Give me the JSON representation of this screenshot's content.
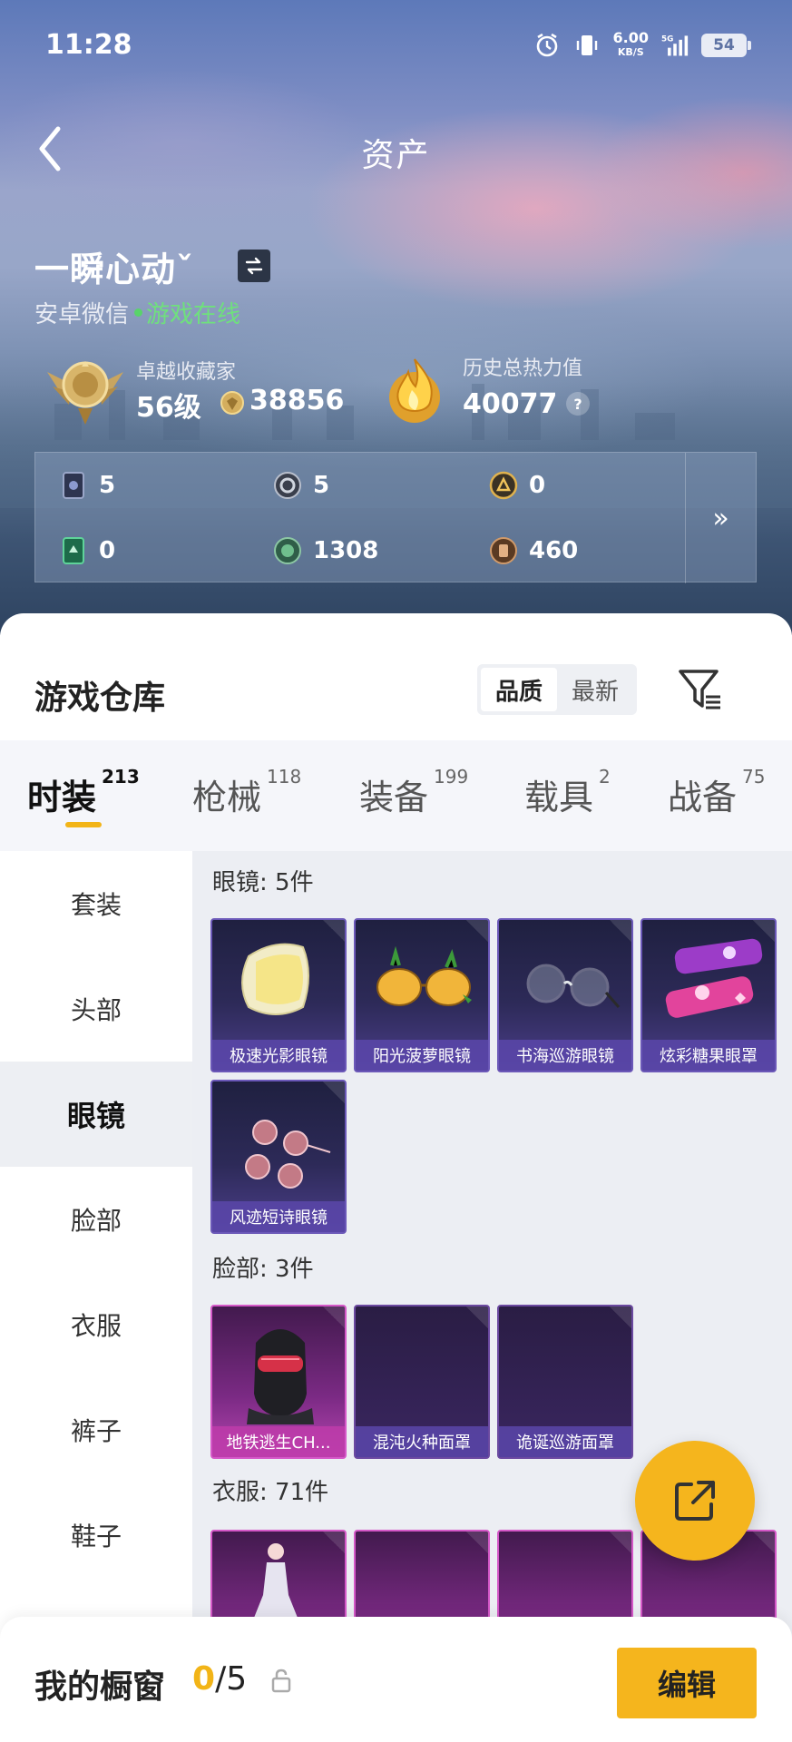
{
  "status_bar": {
    "time": "11:28",
    "speed_value": "6.00",
    "speed_unit": "KB/S",
    "network": "5G",
    "battery": "54"
  },
  "header": {
    "title": "资产"
  },
  "profile": {
    "name": "一瞬心动ˇ",
    "platform": "安卓微信",
    "status": "游戏在线",
    "level_label": "卓越收藏家",
    "level_value": "56级",
    "collector_points": "38856",
    "heat_label": "历史总热力值",
    "heat_value": "40077",
    "help": "?"
  },
  "currencies": [
    {
      "icon": "card-icon",
      "value": "5"
    },
    {
      "icon": "silver-coin-icon",
      "value": "5"
    },
    {
      "icon": "gold-coin-icon",
      "value": "0"
    },
    {
      "icon": "green-card-icon",
      "value": "0"
    },
    {
      "icon": "green-orb-icon",
      "value": "1308"
    },
    {
      "icon": "bronze-coin-icon",
      "value": "460"
    }
  ],
  "currency_more": "»",
  "warehouse": {
    "title": "游戏仓库",
    "sort_options": [
      "品质",
      "最新"
    ],
    "active_sort": "品质"
  },
  "tabs": [
    {
      "label": "时装",
      "count": "213",
      "active": true
    },
    {
      "label": "枪械",
      "count": "118"
    },
    {
      "label": "装备",
      "count": "199"
    },
    {
      "label": "载具",
      "count": "2"
    },
    {
      "label": "战备",
      "count": "75"
    }
  ],
  "sidebar": [
    {
      "label": "套装"
    },
    {
      "label": "头部"
    },
    {
      "label": "眼镜",
      "active": true
    },
    {
      "label": "脸部"
    },
    {
      "label": "衣服"
    },
    {
      "label": "裤子"
    },
    {
      "label": "鞋子"
    }
  ],
  "sections": [
    {
      "title": "眼镜: 5件",
      "items": [
        "极速光影眼镜",
        "阳光菠萝眼镜",
        "书海巡游眼镜",
        "炫彩糖果眼罩",
        "风迹短诗眼镜"
      ]
    },
    {
      "title": "脸部: 3件",
      "items": [
        "地铁逃生CH...",
        "混沌火种面罩",
        "诡诞巡游面罩"
      ]
    },
    {
      "title": "衣服: 71件",
      "items": []
    }
  ],
  "showcase": {
    "label": "我的橱窗",
    "current": "0",
    "total": "/5",
    "edit_label": "编辑"
  },
  "colors": {
    "accent": "#f5b51d",
    "online": "#6fe07d",
    "card_purple": "#4b3e8a",
    "card_pink": "#b545b0"
  }
}
